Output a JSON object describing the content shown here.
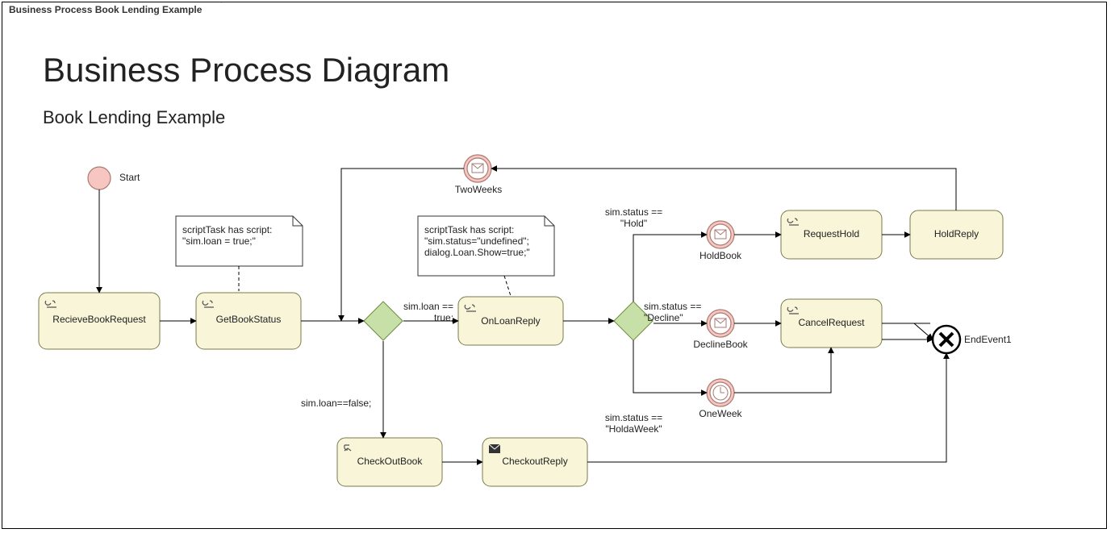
{
  "frame_title": "Business Process Book Lending Example",
  "title": "Business Process Diagram",
  "subtitle": "Book Lending Example",
  "start_label": "Start",
  "tasks": {
    "recieve": "RecieveBookRequest",
    "getstatus": "GetBookStatus",
    "onloan": "OnLoanReply",
    "checkout": "CheckOutBook",
    "checkoutreply": "CheckoutReply",
    "requesthold": "RequestHold",
    "holdreply": "HoldReply",
    "cancelrequest": "CancelRequest"
  },
  "events": {
    "twoweeks": "TwoWeeks",
    "holdbook": "HoldBook",
    "declinebook": "DeclineBook",
    "oneweek": "OneWeek",
    "end": "EndEvent1"
  },
  "conds": {
    "loan_true": "sim.loan ==\ntrue;",
    "loan_false": "sim.loan==false;",
    "hold": "sim.status ==\n\"Hold\"",
    "decline": "sim.status ==\n\"Decline\"",
    "holdaweek": "sim.status ==\n\"HoldaWeek\""
  },
  "notes": {
    "n1": "scriptTask has script:\n\"sim.loan = true;\"",
    "n2": "scriptTask has script:\n\"sim.status=\"undefined\";\ndialog.Loan.Show=true;\""
  }
}
